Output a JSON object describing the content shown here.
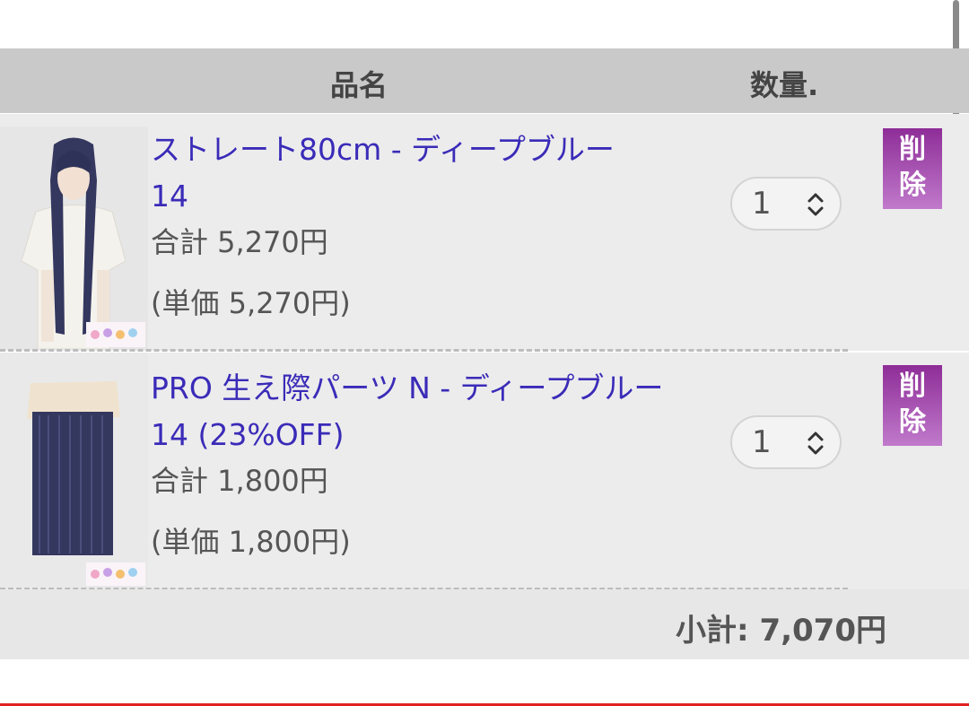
{
  "header": {
    "col_name": "品名",
    "col_qty": "数量."
  },
  "items": [
    {
      "title_line1": "ストレート80cm - ディープブルー",
      "title_line2": "14",
      "total": "合計 5,270円",
      "unit_price": "(単価 5,270円)",
      "quantity": "1",
      "delete_label_1": "削",
      "delete_label_2": "除"
    },
    {
      "title_line1": "PRO 生え際パーツ N - ディープブルー",
      "title_line2": "14 (23%OFF)",
      "total": "合計 1,800円",
      "unit_price": "(単価 1,800円)",
      "quantity": "1",
      "delete_label_1": "削",
      "delete_label_2": "除"
    }
  ],
  "subtotal": "小計: 7,070円",
  "colors": {
    "link": "#3a2bb8",
    "delete_button": "#9b3fa8",
    "accent_line": "#e02020"
  },
  "icons": {
    "quantity_chevron": "chevron-up-down-icon"
  }
}
